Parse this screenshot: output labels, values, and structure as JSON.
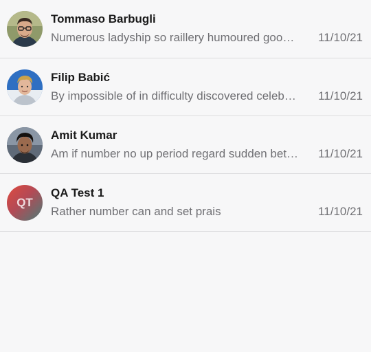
{
  "conversations": [
    {
      "name": "Tommaso Barbugli",
      "preview": "Numerous ladyship so raillery humoured goodness",
      "date": "11/10/21",
      "avatar": "photo-avatar-glasses-man"
    },
    {
      "name": "Filip Babić",
      "preview": "By impossible of in difficulty discovered celebrated",
      "date": "11/10/21",
      "avatar": "photo-avatar-blond-man"
    },
    {
      "name": "Amit Kumar",
      "preview": "Am if number no up period regard sudden better",
      "date": "11/10/21",
      "avatar": "photo-avatar-dark-hair-man"
    },
    {
      "name": "QA Test 1",
      "preview": "Rather number can and set prais",
      "date": "11/10/21",
      "avatar_initials": "QT"
    }
  ]
}
